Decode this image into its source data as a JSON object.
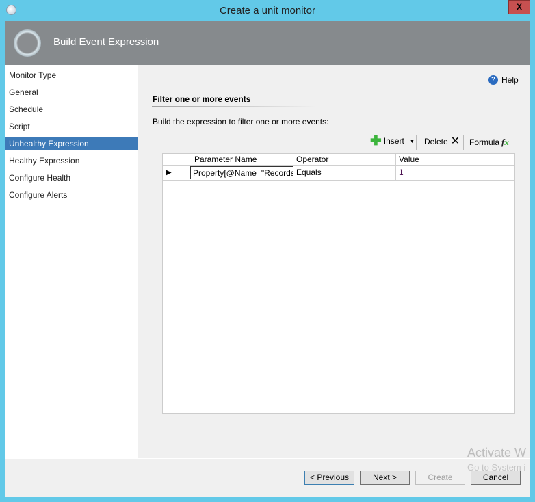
{
  "window": {
    "title": "Create a unit monitor",
    "close_label": "X"
  },
  "header": {
    "title": "Build Event Expression"
  },
  "nav": {
    "items": [
      {
        "label": "Monitor Type"
      },
      {
        "label": "General"
      },
      {
        "label": "Schedule"
      },
      {
        "label": "Script"
      },
      {
        "label": "Unhealthy Expression",
        "selected": true
      },
      {
        "label": "Healthy Expression"
      },
      {
        "label": "Configure Health"
      },
      {
        "label": "Configure Alerts"
      }
    ]
  },
  "main": {
    "help": "Help",
    "section_title": "Filter one or more events",
    "instruction": "Build the expression to filter one or more events:"
  },
  "toolbar": {
    "insert": "Insert",
    "delete": "Delete",
    "formula": "Formula"
  },
  "grid": {
    "columns": [
      "Parameter Name",
      "Operator",
      "Value"
    ],
    "rows": [
      [
        "Property[@Name=\"Records\"]",
        "Equals",
        "1"
      ]
    ]
  },
  "buttons": {
    "previous": "< Previous",
    "next": "Next >",
    "create": "Create",
    "cancel": "Cancel"
  },
  "watermark": {
    "line1": "Activate W",
    "line2": "Go to System i"
  },
  "colors": {
    "titlebar": "#62c9e8",
    "header": "#868a8d",
    "selected": "#3d7ab8",
    "close": "#c75050"
  }
}
